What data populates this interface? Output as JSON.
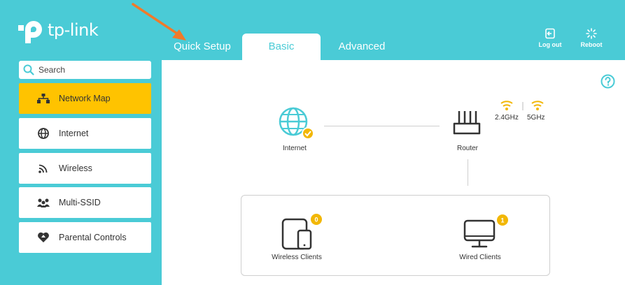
{
  "header": {
    "brand": "tp-link",
    "tabs": [
      "Quick Setup",
      "Basic",
      "Advanced"
    ],
    "active_tab": "Basic",
    "logout_label": "Log out",
    "reboot_label": "Reboot"
  },
  "sidebar": {
    "search_placeholder": "Search",
    "items": [
      {
        "label": "Network Map",
        "icon": "network-map-icon",
        "active": true
      },
      {
        "label": "Internet",
        "icon": "globe-icon",
        "active": false
      },
      {
        "label": "Wireless",
        "icon": "wifi-icon",
        "active": false
      },
      {
        "label": "Multi-SSID",
        "icon": "multi-user-icon",
        "active": false
      },
      {
        "label": "Parental Controls",
        "icon": "heart-icon",
        "active": false
      }
    ]
  },
  "map": {
    "internet_label": "Internet",
    "router_label": "Router",
    "band_24": "2.4GHz",
    "band_5": "5GHz",
    "wireless_clients_label": "Wireless Clients",
    "wireless_clients_count": "0",
    "wired_clients_label": "Wired Clients",
    "wired_clients_count": "1"
  },
  "colors": {
    "brand_teal": "#4acbd6",
    "active_yellow": "#ffc300",
    "annotation_orange": "#f07a2a"
  }
}
